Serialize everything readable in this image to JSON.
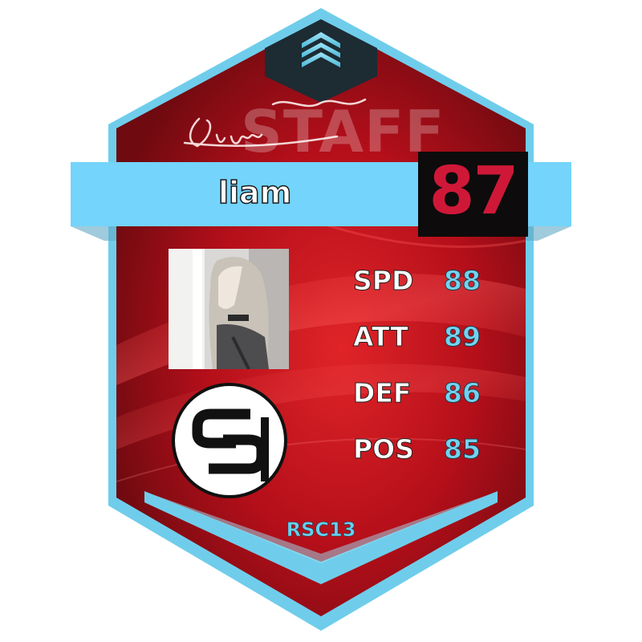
{
  "card": {
    "signature_text": "liam",
    "role": "STAFF",
    "player_name": "liam",
    "overall_rating": "87",
    "stats": [
      {
        "label": "SPD",
        "value": "88"
      },
      {
        "label": "ATT",
        "value": "89"
      },
      {
        "label": "DEF",
        "value": "86"
      },
      {
        "label": "POS",
        "value": "85"
      }
    ],
    "footer_code": "RSC13",
    "team_logo_icon": "sa-team-logo-icon",
    "top_emblem_icon": "chevron-stack-icon",
    "portrait": "anime-character-portrait"
  },
  "colors": {
    "card_red": "#b50f1a",
    "frame_blue": "#6fcdeb",
    "banner_blue": "#74d4fb",
    "rating_red": "#cf1838",
    "rating_bg": "#0d0b0c"
  }
}
